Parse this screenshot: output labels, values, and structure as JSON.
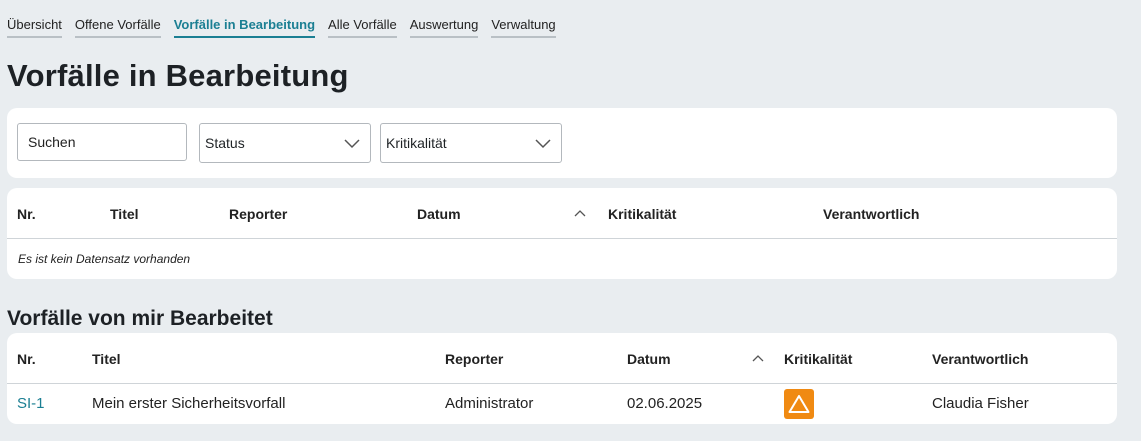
{
  "nav": {
    "tabs": [
      {
        "label": "Übersicht"
      },
      {
        "label": "Offene Vorfälle"
      },
      {
        "label": "Vorfälle in Bearbeitung"
      },
      {
        "label": "Alle Vorfälle"
      },
      {
        "label": "Auswertung"
      },
      {
        "label": "Verwaltung"
      }
    ],
    "active_tab": "Vorfälle in Bearbeitung"
  },
  "page": {
    "title": "Vorfälle in Bearbeitung"
  },
  "filters": {
    "search_placeholder": "Suchen",
    "status_label": "Status",
    "kritikalitaet_label": "Kritikalität"
  },
  "table1": {
    "columns": [
      "Nr.",
      "Titel",
      "Reporter",
      "Datum",
      "Kritikalität",
      "Verantwortlich"
    ],
    "sorted_column": "Datum",
    "empty_text": "Es ist kein Datensatz vorhanden"
  },
  "section2": {
    "title": "Vorfälle von mir Bearbeitet"
  },
  "table2": {
    "columns": [
      "Nr.",
      "Titel",
      "Reporter",
      "Datum",
      "Kritikalität",
      "Verantwortlich"
    ],
    "sorted_column": "Datum",
    "rows": [
      {
        "nr": "SI-1",
        "titel": "Mein erster Sicherheitsvorfall",
        "reporter": "Administrator",
        "datum": "02.06.2025",
        "kritikalitaet_icon": "warning-triangle-icon",
        "verantwortlich": "Claudia Fisher"
      }
    ]
  },
  "colors": {
    "accent": "#1b7f93",
    "background": "#e9edf0",
    "warning_badge": "#f08a12"
  }
}
